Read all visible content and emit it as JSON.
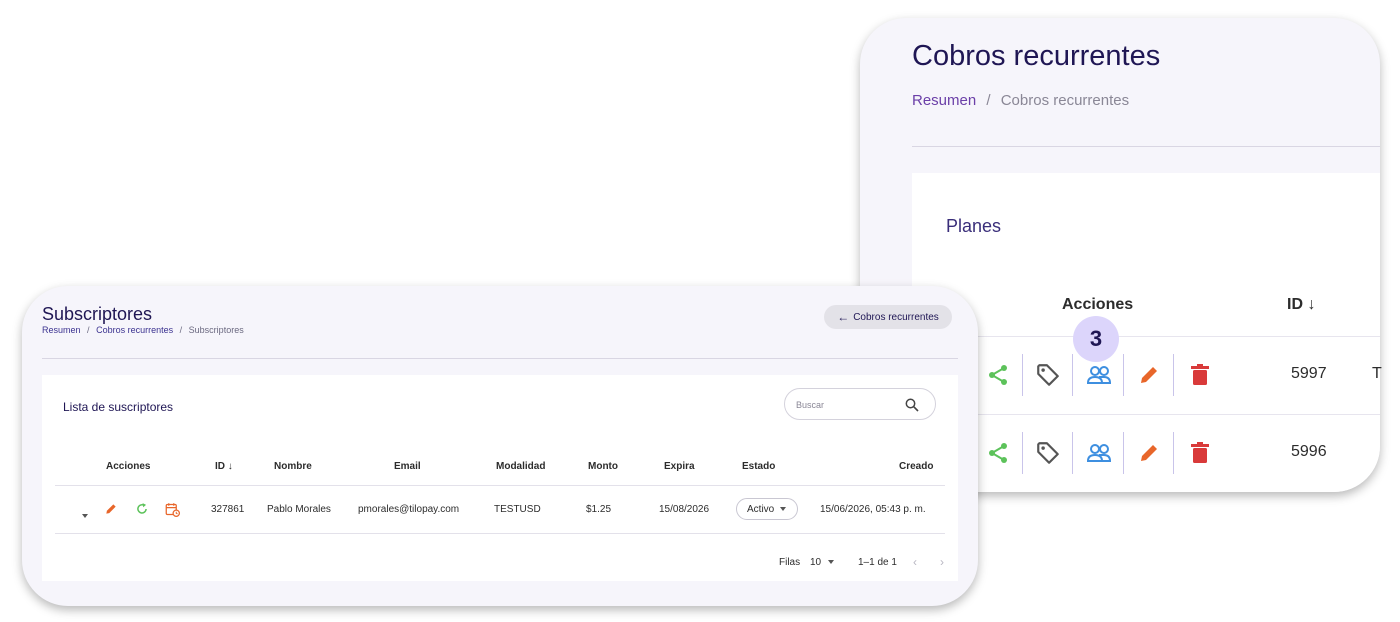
{
  "back_window": {
    "title": "Cobros recurrentes",
    "breadcrumb": {
      "home": "Resumen",
      "separator": "/",
      "current": "Cobros recurrentes"
    },
    "section_title": "Planes",
    "headers": {
      "acciones": "Acciones",
      "id": "ID ↓"
    },
    "badge": "3",
    "action_icons": [
      "share-icon",
      "tag-icon",
      "users-icon",
      "pencil-icon",
      "trash-icon"
    ],
    "rows": [
      {
        "id": "5997",
        "next_char": "T"
      },
      {
        "id": "5996"
      }
    ]
  },
  "front_window": {
    "title": "Subscriptores",
    "breadcrumb": {
      "home": "Resumen",
      "separator": "/",
      "middle": "Cobros recurrentes",
      "current": "Subscriptores"
    },
    "back_button": "Cobros recurrentes",
    "list_title": "Lista de suscriptores",
    "search": {
      "placeholder": "Buscar",
      "value": ""
    },
    "columns": {
      "acciones": "Acciones",
      "id": "ID ↓",
      "nombre": "Nombre",
      "email": "Email",
      "modalidad": "Modalidad",
      "monto": "Monto",
      "expira": "Expira",
      "estado": "Estado",
      "creado": "Creado"
    },
    "row": {
      "id": "327861",
      "nombre": "Pablo Morales",
      "email": "pmorales@tilopay.com",
      "modalidad": "TESTUSD",
      "monto": "$1.25",
      "expira": "15/08/2026",
      "estado": "Activo",
      "creado": "15/06/2026, 05:43 p. m."
    },
    "pagination": {
      "rows_label": "Filas",
      "rows_value": "10",
      "range": "1–1 de 1"
    }
  },
  "colors": {
    "title": "#1f1654",
    "link": "#6b3fa8",
    "share": "#5cc25a",
    "tag": "#555555",
    "users": "#3e8fe0",
    "edit": "#e8662a",
    "delete": "#d93a3a",
    "badge": "#dcd5fb"
  }
}
